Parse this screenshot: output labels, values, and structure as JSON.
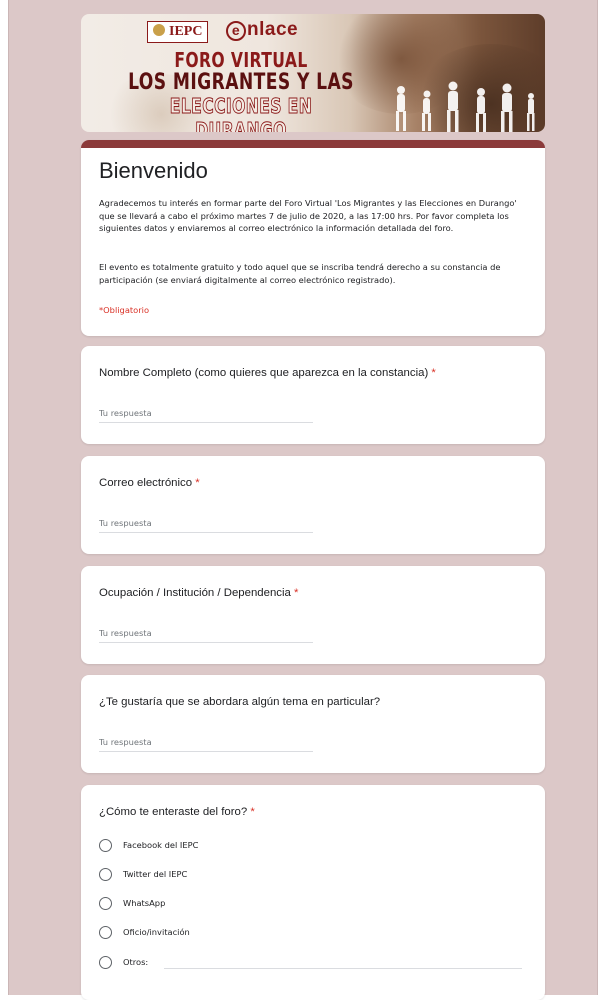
{
  "header": {
    "logo_iepc": "IEPC",
    "logo_enlace": "nlace",
    "logo_enlace_e": "e",
    "title_line1": "FORO VIRTUAL",
    "title_line2": "LOS MIGRANTES Y LAS",
    "title_line3": "ELECCIONES EN DURANGO"
  },
  "theme": {
    "accent": "#8b3a3a",
    "background": "#dcc8c8",
    "required": "#d93025"
  },
  "welcome": {
    "title": "Bienvenido",
    "paragraph1": "Agradecemos tu interés en formar parte del Foro Virtual 'Los Migrantes y las Elecciones en Durango' que se llevará a cabo el próximo martes 7 de julio de 2020, a las 17:00 hrs. Por favor completa los siguientes datos y enviaremos al correo electrónico la información detallada del foro.",
    "paragraph2": "El evento es totalmente gratuito y todo aquel que se inscriba tendrá derecho a su constancia de participación (se enviará digitalmente al correo electrónico registrado).",
    "required_note": "*Obligatorio"
  },
  "questions": [
    {
      "label": "Nombre Completo (como quieres que aparezca en la constancia)",
      "required_mark": "*",
      "placeholder": "Tu respuesta",
      "value": ""
    },
    {
      "label": "Correo electrónico",
      "required_mark": "*",
      "placeholder": "Tu respuesta",
      "value": ""
    },
    {
      "label": "Ocupación / Institución / Dependencia",
      "required_mark": "*",
      "placeholder": "Tu respuesta",
      "value": ""
    },
    {
      "label": "¿Te gustaría que se abordara algún tema en particular?",
      "required_mark": "",
      "placeholder": "Tu respuesta",
      "value": ""
    },
    {
      "label": "¿Cómo te enteraste del foro?",
      "required_mark": "*",
      "options": [
        "Facebook del IEPC",
        "Twitter del IEPC",
        "WhatsApp",
        "Oficio/invitación",
        "Otros:"
      ]
    }
  ]
}
